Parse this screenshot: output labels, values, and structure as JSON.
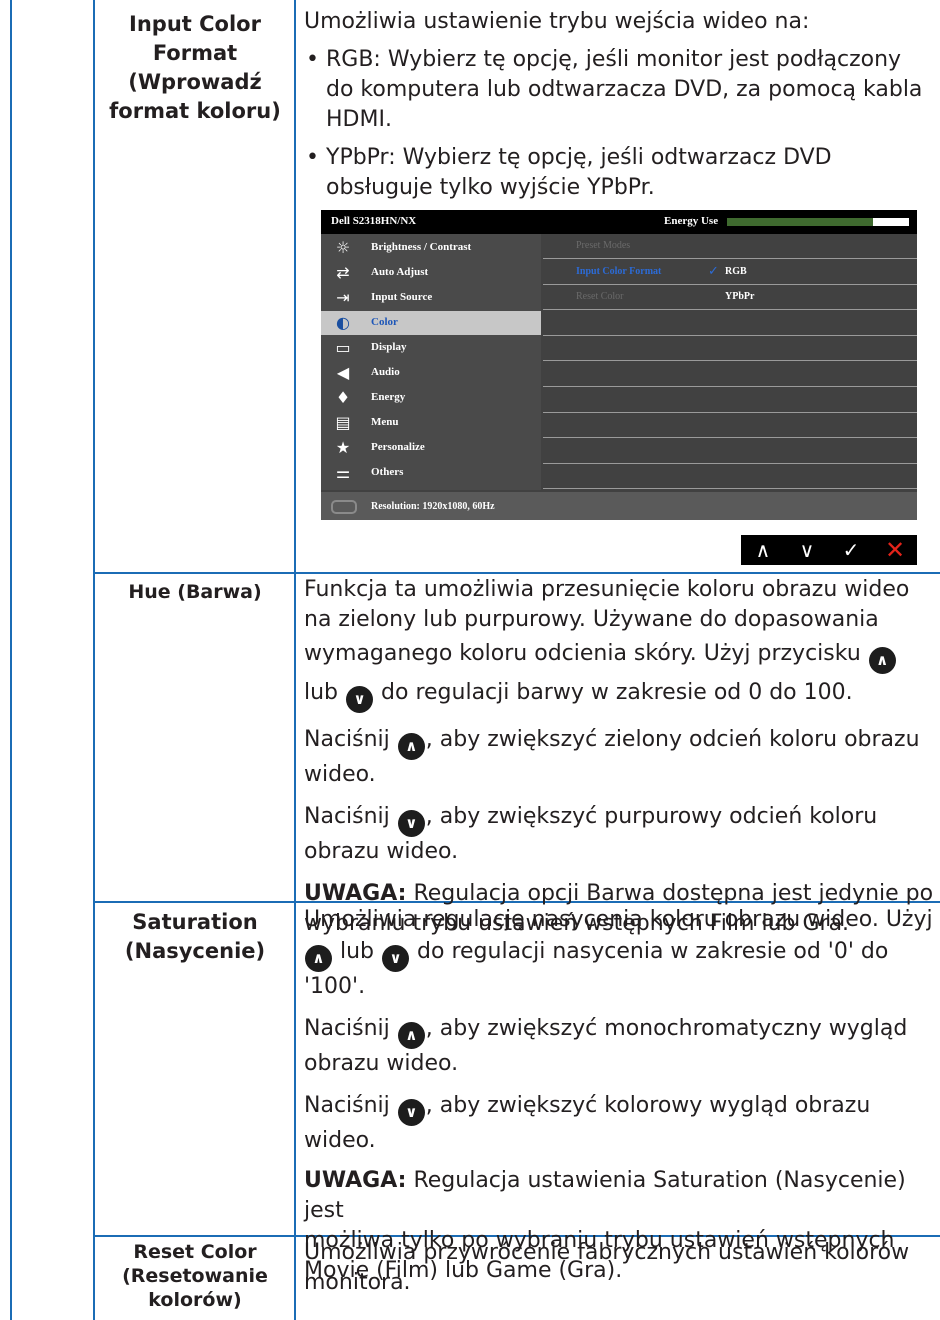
{
  "rows": {
    "input_color_format": {
      "label": "Input Color Format (Wprowadź format koloru)",
      "label_lines": [
        "Input Color",
        "Format",
        "(Wprowadź",
        "format koloru)"
      ],
      "desc_lines": [
        "Umożliwia ustawienie trybu wejścia wideo na:"
      ],
      "bullets": [
        [
          "RGB: Wybierz tę opcję, jeśli monitor jest podłączony",
          "do komputera lub odtwarzacza DVD, za pomocą kabla",
          "HDMI."
        ],
        [
          "YPbPr: Wybierz tę opcję, jeśli odtwarzacz DVD",
          "obsługuje tylko wyjście YPbPr."
        ]
      ]
    },
    "hue": {
      "label": "Hue (Barwa)",
      "p1_lines": [
        "Funkcja ta umożliwia przesunięcie koloru obrazu wideo",
        "na zielony lub purpurowy. Używane do dopasowania"
      ],
      "p1_line3a": "wymaganego koloru odcienia skóry. Użyj przycisku",
      "p1_line4a": "lub",
      "p1_line4b": "do regulacji barwy w zakresie od 0 do 100.",
      "p2a": "Naciśnij",
      "p2b": ", aby zwiększyć zielony odcień koloru obrazu",
      "p2c": "wideo.",
      "p3a": "Naciśnij",
      "p3b": ", aby zwiększyć purpurowy odcień koloru",
      "p3c": "obrazu wideo.",
      "note_bold": "UWAGA:",
      "note_line1": " Regulacja opcji Barwa dostępna jest jedynie po",
      "note_line2": "wybraniu trybu ustawień wstępnych Film lub Gra."
    },
    "saturation": {
      "label_lines": [
        "Saturation",
        "(Nasycenie)"
      ],
      "p1_line1": "Umożliwia regulację nasycenia koloru obrazu wideo. Użyj",
      "p1_line2a": "lub",
      "p1_line2b": "do regulacji nasycenia w zakresie od '0' do",
      "p1_line3": "'100'.",
      "p2a": "Naciśnij",
      "p2b": ", aby zwiększyć monochromatyczny wygląd",
      "p2c": "obrazu wideo.",
      "p3a": "Naciśnij",
      "p3b": ", aby zwiększyć kolorowy wygląd obrazu",
      "p3c": "wideo.",
      "note_bold": "UWAGA:",
      "note_line1": " Regulacja ustawienia Saturation (Nasycenie) jest",
      "note_line2": "możliwa tylko po wybraniu trybu ustawień wstępnych",
      "note_line3": "Movie (Film) lub Game (Gra)."
    },
    "reset_color": {
      "label_lines": [
        "Reset Color",
        "(Resetowanie",
        "kolorów)"
      ],
      "desc_lines": [
        "Umożliwia przywrócenie fabrycznych ustawień kolorów",
        "monitora."
      ]
    }
  },
  "osd": {
    "model": "Dell S2318HN/NX",
    "energy_label": "Energy Use",
    "energy_level": 0.8,
    "menu": [
      {
        "label": "Brightness / Contrast",
        "icon": "brightness-icon",
        "glyph": "☼"
      },
      {
        "label": "Auto Adjust",
        "icon": "auto-adjust-icon",
        "glyph": "⇄"
      },
      {
        "label": "Input Source",
        "icon": "input-source-icon",
        "glyph": "⇥"
      },
      {
        "label": "Color",
        "icon": "color-icon",
        "glyph": "◐"
      },
      {
        "label": "Display",
        "icon": "display-icon",
        "glyph": "▭"
      },
      {
        "label": "Audio",
        "icon": "audio-icon",
        "glyph": "◀"
      },
      {
        "label": "Energy",
        "icon": "energy-icon",
        "glyph": "♦"
      },
      {
        "label": "Menu",
        "icon": "menu-icon",
        "glyph": "▤"
      },
      {
        "label": "Personalize",
        "icon": "star-icon",
        "glyph": "★"
      },
      {
        "label": "Others",
        "icon": "others-icon",
        "glyph": "⚌"
      }
    ],
    "selected_menu": "Color",
    "submenu": [
      {
        "label": "Preset Modes",
        "active": false,
        "value": ""
      },
      {
        "label": "Input Color Format",
        "active": true,
        "value": "RGB",
        "checked": true
      },
      {
        "label": "Reset Color",
        "active": false,
        "value": "YPbPr"
      }
    ],
    "resolution": "Resolution: 1920x1080, 60Hz",
    "nav_buttons": [
      "up-icon",
      "down-icon",
      "check-icon",
      "close-icon"
    ],
    "nav_glyphs": [
      "∧",
      "∨",
      "✓",
      "✕"
    ]
  },
  "colors": {
    "grid": "#1b6cb5",
    "osd_bg": "#414141",
    "highlight": "#2c6bd6",
    "close": "#e2231a"
  }
}
